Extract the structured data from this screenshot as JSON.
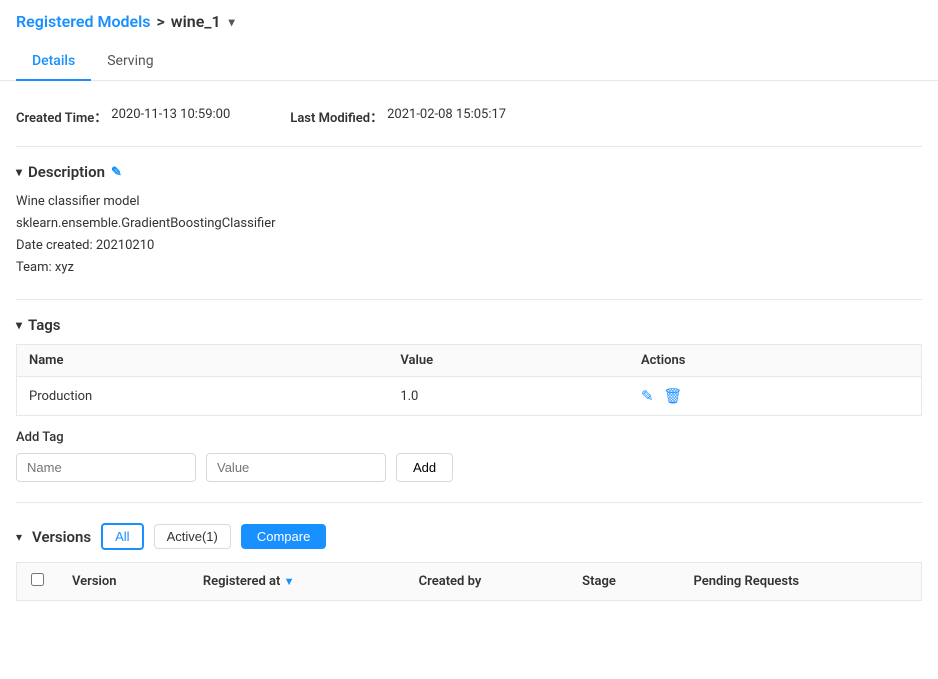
{
  "breadcrumb": {
    "parent_label": "Registered Models",
    "separator": ">",
    "current": "wine_1",
    "dropdown_icon": "▾"
  },
  "tabs": [
    {
      "id": "details",
      "label": "Details",
      "active": true
    },
    {
      "id": "serving",
      "label": "Serving",
      "active": false
    }
  ],
  "meta": {
    "created_label": "Created Time：",
    "created_value": "2020-11-13 10:59:00",
    "modified_label": "Last Modified：",
    "modified_value": "2021-02-08 15:05:17"
  },
  "description": {
    "section_title": "Description",
    "toggle": "▾",
    "edit_icon": "✎",
    "lines": [
      "Wine classifier model",
      "sklearn.ensemble.GradientBoostingClassifier",
      "Date created: 20210210",
      "Team: xyz"
    ]
  },
  "tags": {
    "section_title": "Tags",
    "toggle": "▾",
    "columns": [
      "Name",
      "Value",
      "Actions"
    ],
    "rows": [
      {
        "name": "Production",
        "value": "1.0"
      }
    ]
  },
  "add_tag": {
    "label": "Add Tag",
    "name_placeholder": "Name",
    "value_placeholder": "Value",
    "add_button": "Add"
  },
  "versions": {
    "section_title": "Versions",
    "toggle": "▾",
    "filters": [
      "All",
      "Active(1)"
    ],
    "active_filter": "All",
    "compare_button": "Compare",
    "columns": [
      "",
      "Version",
      "Registered at",
      "Created by",
      "Stage",
      "Pending Requests"
    ]
  }
}
